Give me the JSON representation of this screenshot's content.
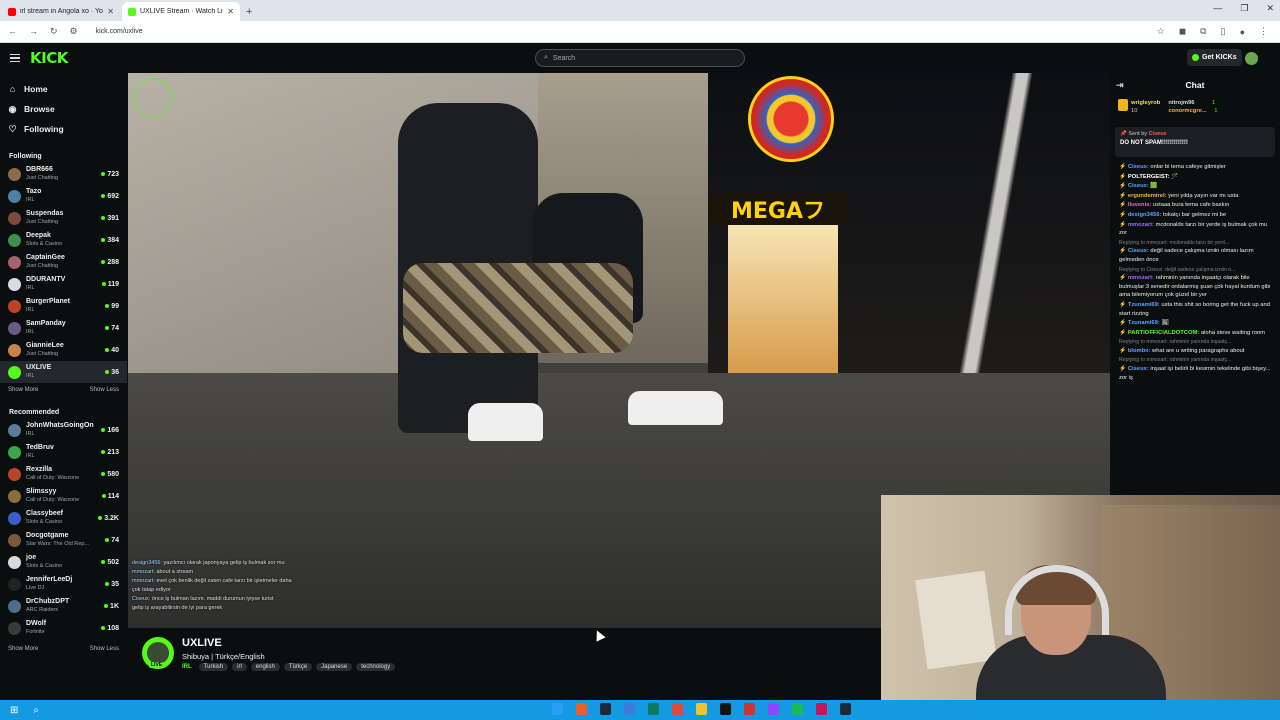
{
  "browser": {
    "tabs": [
      {
        "title": "irl stream in Angola xo · YouTube",
        "color": "#ff0000",
        "active": false
      },
      {
        "title": "UXLIVE Stream · Watch Live",
        "color": "#53fc18",
        "active": true
      }
    ],
    "new_tab": "+",
    "url": "kick.com/uxlive"
  },
  "header": {
    "logo": "KICK",
    "search_placeholder": "Search",
    "get_kicks": "Get KICKs"
  },
  "sidebar": {
    "nav": [
      {
        "label": "Home",
        "icon": "⌂"
      },
      {
        "label": "Browse",
        "icon": "◉"
      },
      {
        "label": "Following",
        "icon": "♡"
      }
    ],
    "following_title": "Following",
    "following": [
      {
        "name": "DBR666",
        "category": "Just Chatting",
        "viewers": "723",
        "color": "#8a6b4d"
      },
      {
        "name": "Tazo",
        "category": "IRL",
        "viewers": "692",
        "color": "#4f7fa8"
      },
      {
        "name": "Suspendas",
        "category": "Just Chatting",
        "viewers": "391",
        "color": "#7a4a3c"
      },
      {
        "name": "Deepak",
        "category": "Slots & Casino",
        "viewers": "384",
        "color": "#3f8f4c"
      },
      {
        "name": "CaptainGee",
        "category": "Just Chatting",
        "viewers": "288",
        "color": "#a85f6f"
      },
      {
        "name": "DDURANTV",
        "category": "IRL",
        "viewers": "119",
        "color": "#dcdcdc"
      },
      {
        "name": "BurgerPlanet",
        "category": "IRL",
        "viewers": "99",
        "color": "#c2402a"
      },
      {
        "name": "SamPanday",
        "category": "IRL",
        "viewers": "74",
        "color": "#6a5a8c"
      },
      {
        "name": "GiannieLee",
        "category": "Just Chatting",
        "viewers": "40",
        "color": "#c9824a"
      },
      {
        "name": "UXLIVE",
        "category": "IRL",
        "viewers": "36",
        "color": "#53fc18"
      }
    ],
    "show_more": "Show More",
    "show_less": "Show Less",
    "recommended_title": "Recommended",
    "recommended": [
      {
        "name": "JohnWhatsGoingOn",
        "category": "IRL",
        "viewers": "166",
        "color": "#5a7e9a"
      },
      {
        "name": "TedBruv",
        "category": "IRL",
        "viewers": "213",
        "color": "#3aa64c"
      },
      {
        "name": "Rexzilla",
        "category": "Call of Duty: Warzone",
        "viewers": "580",
        "color": "#b8432e"
      },
      {
        "name": "Slimssyy",
        "category": "Call of Duty: Warzone",
        "viewers": "114",
        "color": "#8a6e3c"
      },
      {
        "name": "Classybeef",
        "category": "Slots & Casino",
        "viewers": "3.2K",
        "color": "#3a5ec9"
      },
      {
        "name": "Docgotgame",
        "category": "Star Wars: The Old Rep...",
        "viewers": "74",
        "color": "#7a5a3c"
      },
      {
        "name": "joe",
        "category": "Slots & Casino",
        "viewers": "502",
        "color": "#d9d9d9"
      },
      {
        "name": "JenniferLeeDj",
        "category": "Live DJ",
        "viewers": "35",
        "color": "#222"
      },
      {
        "name": "DrChubzDPT",
        "category": "ARC Raiders",
        "viewers": "1K",
        "color": "#4c6e8c"
      },
      {
        "name": "DWolf",
        "category": "Fortnite",
        "viewers": "108",
        "color": "#3a3a3a"
      }
    ]
  },
  "video_overlay_chat": [
    {
      "user": "design3456:",
      "text": "yazılımcı olarak japonyaya gelip iş bulmak zor mu"
    },
    {
      "user": "mmozart:",
      "text": "about a stream"
    },
    {
      "user": "mmozart:",
      "text": "evet çok benlik değil zaten cafe tarzı bir işletmeler daha"
    },
    {
      "user": "",
      "text": "çok tatap ediyor"
    },
    {
      "user": "Ciseux:",
      "text": "önce iş bulman lazım. maddi durumun iyiyse turist"
    },
    {
      "user": "",
      "text": "gelip iş arayabilirsin de iyi para gerek"
    }
  ],
  "stream_info": {
    "channel": "UXLIVE",
    "live_badge": "LIVE",
    "title": "Shibuya | Türkçe/English",
    "category": "IRL",
    "tags": [
      "Turkish",
      "irl",
      "english",
      "Türkçe",
      "Japanese",
      "technology"
    ]
  },
  "chat": {
    "title": "Chat",
    "gifters": [
      {
        "name": "wrigleyrob",
        "count": "10"
      },
      {
        "name": "nitrojm96",
        "count": "1"
      },
      {
        "name": "conormcgre...",
        "count": "1"
      }
    ],
    "pinned": {
      "sent_by_label": "Sent by",
      "sender": "Ciseux",
      "message": "DO NOT SPAM!!!!!!!!!!!!!"
    },
    "messages": [
      {
        "reply": "",
        "user": "Ciseux:",
        "color": "#5aa7ff",
        "text": "onlar bi tema cafeye gitmişler"
      },
      {
        "reply": "",
        "user": "POLTERGEIST:",
        "color": "#ffffff",
        "text": "🪄"
      },
      {
        "reply": "",
        "user": "Ciseux:",
        "color": "#5aa7ff",
        "text": "🟩"
      },
      {
        "reply": "",
        "user": "ergundemirel:",
        "color": "#f5b34c",
        "text": "yeni yılda yayın var mı usta"
      },
      {
        "reply": "",
        "user": "lluvenis:",
        "color": "#e86cc6",
        "text": "ustaaa bura tema cafe baskın"
      },
      {
        "reply": "",
        "user": "design3456:",
        "color": "#5aa7ff",
        "text": "tokatçı bar gelmez mi be"
      },
      {
        "reply": "",
        "user": "mmozart:",
        "color": "#9f6bff",
        "text": "mcdonalds tarzı bir yerde iş bulmak çok mu zor"
      },
      {
        "reply": "Replying to mmozart: mcdonalds tarzı bir yerd...",
        "user": "Ciseux:",
        "color": "#5aa7ff",
        "text": "değil sadece çalışma izniin olması lazım gelmeden önce"
      },
      {
        "reply": "Replying to Ciseux: değil sadece çalışma izniin o...",
        "user": "mmozart:",
        "color": "#9f6bff",
        "text": "rahminin yanında inşaatçı olarak bile bulmuşlar 3 senedir ordalarmış şuan çok hayal kurdum gibi ama bilemiyorum çok güzel bir yer"
      },
      {
        "reply": "",
        "user": "Tzunami69:",
        "color": "#5aa7ff",
        "text": "usta this shit so boring get the fuck up and start rizzing"
      },
      {
        "reply": "",
        "user": "Tzunami69:",
        "color": "#5aa7ff",
        "text": "🖼"
      },
      {
        "reply": "",
        "user": "PARTIOFFICIALDOTCOM:",
        "color": "#53fc18",
        "text": "aloha steve waiting room"
      },
      {
        "reply": "Replying to mmozart: rahminin yanında inşaatç...",
        "user": "blombx:",
        "color": "#5aa7ff",
        "text": "what are u writing paragraphs about"
      },
      {
        "reply": "Replying to mmozart: rahminin yanında inşaatç...",
        "user": "Ciseux:",
        "color": "#5aa7ff",
        "text": "inşaat işi belirli bi kesimin tekelinde gibi bişey... zor iş"
      }
    ]
  }
}
